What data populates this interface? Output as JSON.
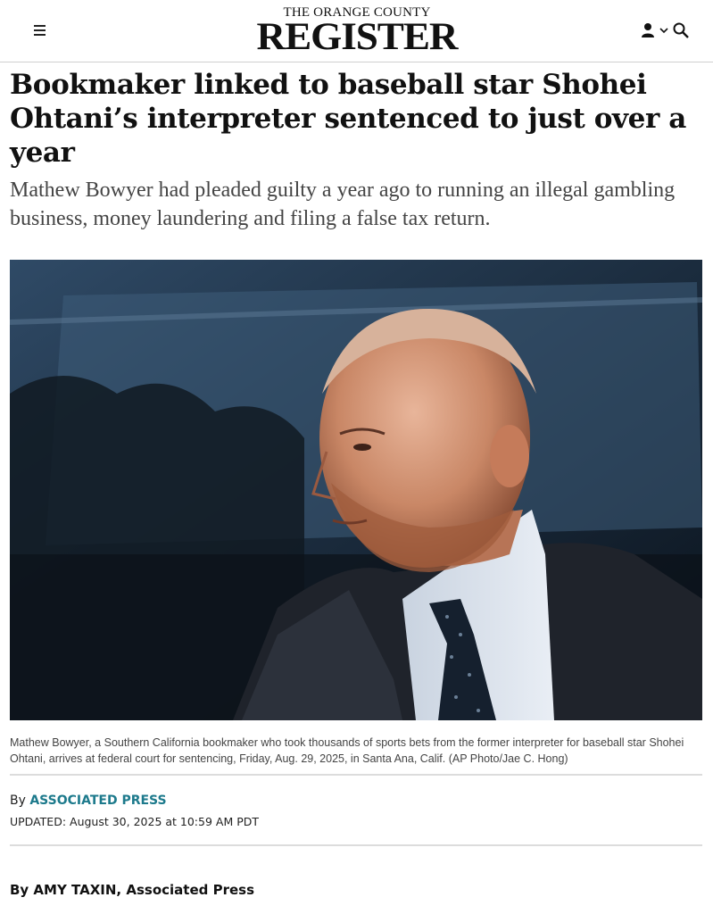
{
  "masthead": {
    "top_line": "THE ORANGE COUNTY",
    "title": "REGISTER"
  },
  "header_icons": {
    "menu": "menu-icon",
    "user": "user-icon",
    "dropdown": "chevron-down-icon",
    "search": "search-icon"
  },
  "article": {
    "headline": "Bookmaker linked to baseball star Shohei Ohtani’s interpreter sentenced to just over a year",
    "dek": "Mathew Bowyer had pleaded guilty a year ago to running an illegal gambling business, money laundering and filing a false tax return.",
    "photo_caption": "Mathew Bowyer, a Southern California bookmaker who took thousands of sports bets from the former interpreter for baseball star Shohei Ohtani, arrives at federal court for sentencing, Friday, Aug. 29, 2025, in Santa Ana, Calif. (AP Photo/Jae C. Hong)",
    "byline_prefix": "By",
    "byline_source": "ASSOCIATED PRESS",
    "updated": "UPDATED: August 30, 2025 at 10:59 AM PDT",
    "author_line": "By AMY TAXIN, Associated Press"
  }
}
